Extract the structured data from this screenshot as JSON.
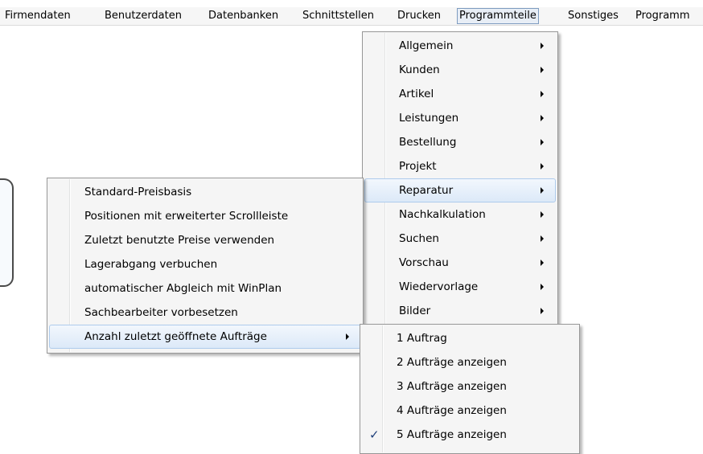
{
  "menubar": {
    "items": [
      "Firmendaten",
      "Benutzerdaten",
      "Datenbanken",
      "Schnittstellen",
      "Drucken",
      "Programmteile",
      "Sonstiges",
      "Programm"
    ],
    "active": "Programmteile"
  },
  "programmteile_menu": {
    "items": [
      "Allgemein",
      "Kunden",
      "Artikel",
      "Leistungen",
      "Bestellung",
      "Projekt",
      "Reparatur",
      "Nachkalkulation",
      "Suchen",
      "Vorschau",
      "Wiedervorlage",
      "Bilder"
    ],
    "highlighted": "Reparatur"
  },
  "reparatur_menu": {
    "items": [
      "Standard-Preisbasis",
      "Positionen mit erweiterter Scrollleiste",
      "Zuletzt benutzte Preise verwenden",
      "Lagerabgang verbuchen",
      "automatischer Abgleich mit WinPlan",
      "Sachbearbeiter vorbesetzen",
      "Anzahl zuletzt geöffnete Aufträge"
    ],
    "highlighted": "Anzahl zuletzt geöffnete Aufträge"
  },
  "auftraege_menu": {
    "items": [
      "1 Auftrag",
      "2 Aufträge anzeigen",
      "3 Aufträge anzeigen",
      "4 Aufträge anzeigen",
      "5 Aufträge anzeigen"
    ],
    "checked": "5 Aufträge anzeigen",
    "check_glyph": "✓"
  },
  "colors": {
    "highlight_border": "#aecbec",
    "check": "#1e3f7a"
  }
}
